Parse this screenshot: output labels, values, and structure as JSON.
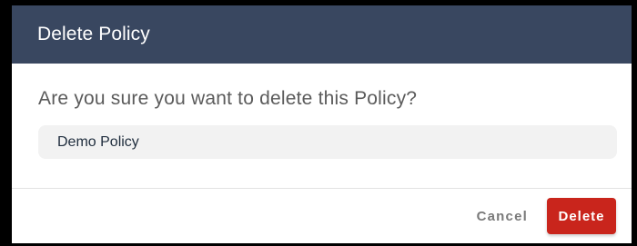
{
  "dialog": {
    "title": "Delete Policy",
    "question": "Are you sure you want to delete this Policy?",
    "item_name": "Demo Policy",
    "cancel_label": "Cancel",
    "delete_label": "Delete"
  },
  "colors": {
    "header_bg": "#394760",
    "delete_button": "#c9251c",
    "chip_bg": "#f2f2f2"
  }
}
